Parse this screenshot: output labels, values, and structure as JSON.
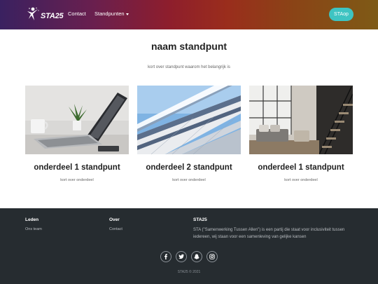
{
  "brand": {
    "name": "STA25"
  },
  "nav": {
    "contact": "Contact",
    "standpunten": "Standpunten",
    "staop": "STAop"
  },
  "main": {
    "title": "naam standpunt",
    "subtitle": "kort over standpunt waarom het belangrijk is",
    "cards": [
      {
        "title": "onderdeel 1 standpunt",
        "text": "kort over onderdeel",
        "image": "laptop-desk"
      },
      {
        "title": "onderdeel 2 standpunt",
        "text": "kort over onderdeel",
        "image": "building-facade"
      },
      {
        "title": "onderdeel 1 standpunt",
        "text": "kort over onderdeel",
        "image": "loft-interior"
      }
    ]
  },
  "footer": {
    "leden": {
      "heading": "Leden",
      "link": "Ons team"
    },
    "over": {
      "heading": "Over",
      "link": "Contact"
    },
    "sta": {
      "heading": "STA25",
      "text": "STA (\"Samenwerking Tussen Allen\") is een partij die staat voor inclusiviteit tussen iedereen, wij staan voor een samenleving van gelijke kansen"
    },
    "socials": [
      "facebook-icon",
      "twitter-icon",
      "snapchat-icon",
      "instagram-icon"
    ],
    "copyright": "STA25 © 2021"
  },
  "colors": {
    "accent": "#3ec4c2",
    "footer_bg": "#262c30",
    "nav_gradient_start": "#3a2160",
    "nav_gradient_end": "#7e5a16"
  }
}
